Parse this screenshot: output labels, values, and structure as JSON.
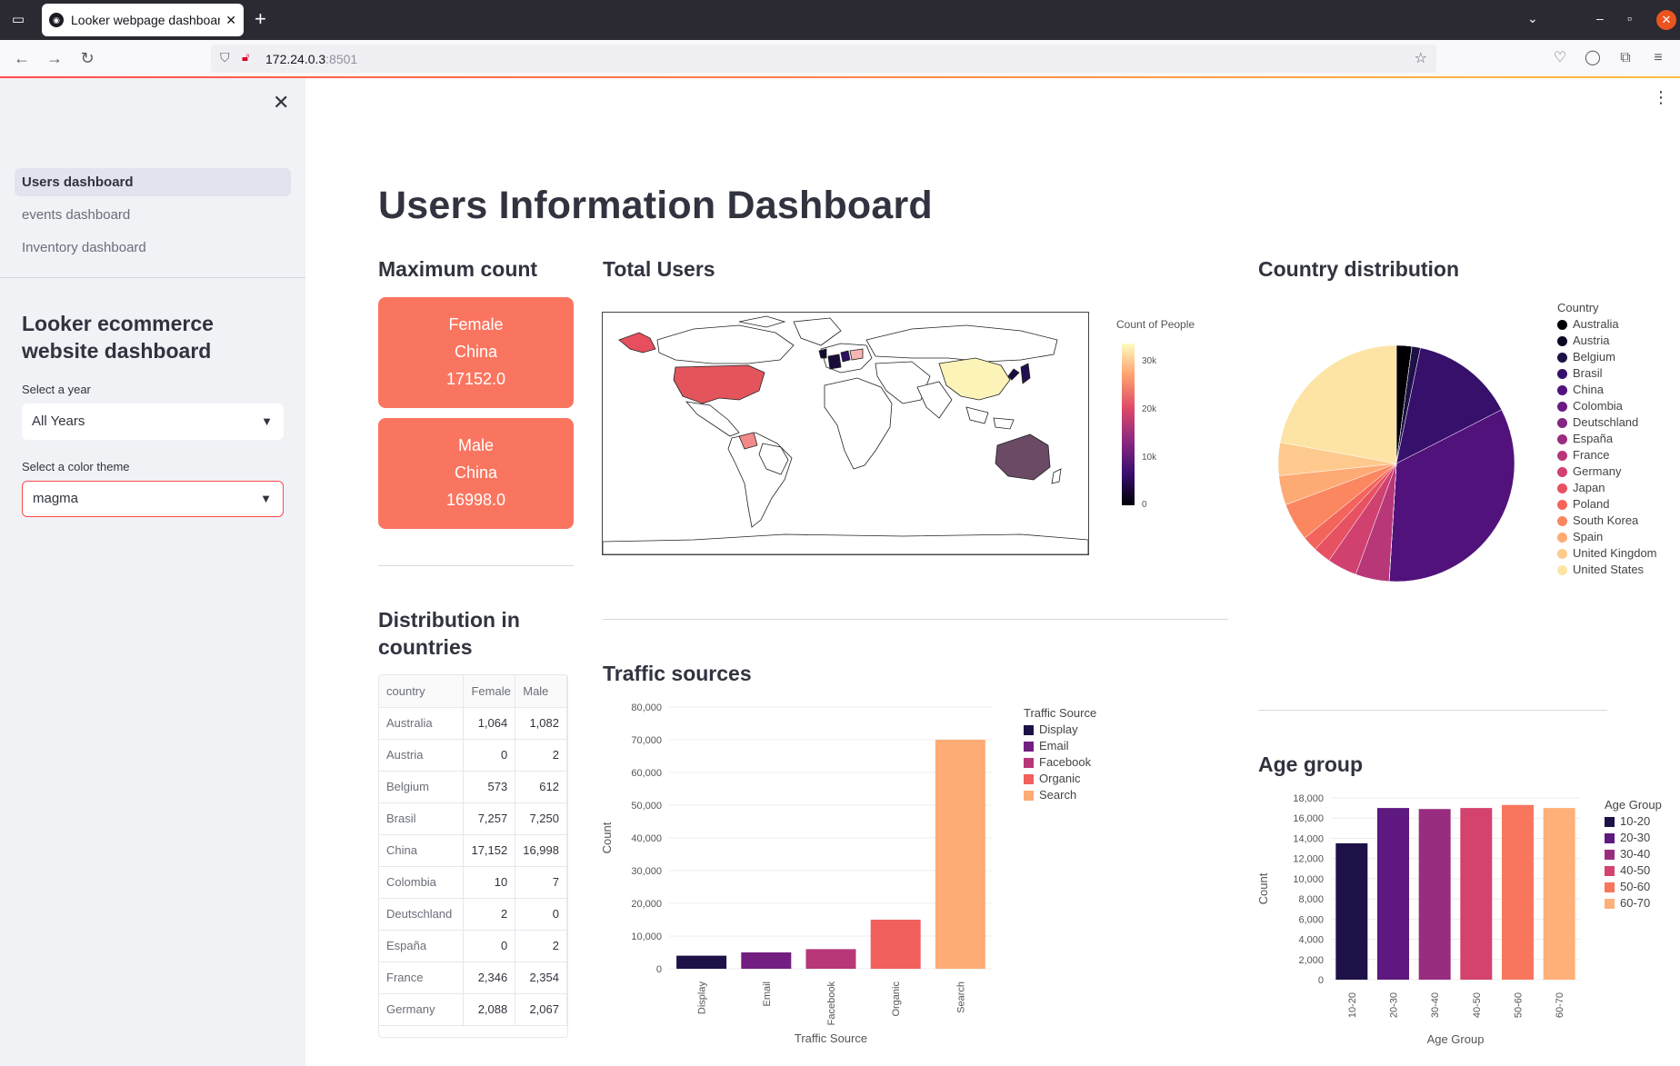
{
  "browser": {
    "tab_title": "Looker webpage dashboard",
    "url_host": "172.24.0.3",
    "url_port": ":8501"
  },
  "sidebar": {
    "nav": [
      {
        "label": "Users dashboard",
        "active": true
      },
      {
        "label": "events dashboard",
        "active": false
      },
      {
        "label": "Inventory dashboard",
        "active": false
      }
    ],
    "title": "Looker ecommerce website dashboard",
    "year_label": "Select a year",
    "year_value": "All Years",
    "theme_label": "Select a color theme",
    "theme_value": "magma"
  },
  "main": {
    "page_title": "Users Information Dashboard",
    "max_count": {
      "heading": "Maximum count",
      "cards": [
        {
          "gender": "Female",
          "country": "China",
          "value": "17152.0"
        },
        {
          "gender": "Male",
          "country": "China",
          "value": "16998.0"
        }
      ]
    },
    "total_users": {
      "heading": "Total Users",
      "colorbar_title": "Count of People",
      "colorbar_ticks": [
        "30k",
        "20k",
        "10k",
        "0"
      ]
    },
    "country_distribution": {
      "heading": "Country distribution"
    },
    "distribution": {
      "heading": "Distribution in countries",
      "columns": [
        "country",
        "Female",
        "Male"
      ],
      "rows": [
        [
          "Australia",
          "1,064",
          "1,082"
        ],
        [
          "Austria",
          "0",
          "2"
        ],
        [
          "Belgium",
          "573",
          "612"
        ],
        [
          "Brasil",
          "7,257",
          "7,250"
        ],
        [
          "China",
          "17,152",
          "16,998"
        ],
        [
          "Colombia",
          "10",
          "7"
        ],
        [
          "Deutschland",
          "2",
          "0"
        ],
        [
          "España",
          "0",
          "2"
        ],
        [
          "France",
          "2,346",
          "2,354"
        ],
        [
          "Germany",
          "2,088",
          "2,067"
        ]
      ]
    },
    "traffic": {
      "heading": "Traffic sources"
    },
    "age": {
      "heading": "Age group"
    }
  },
  "colors": {
    "accent": "#ff4b4b",
    "metric_card": "#fa7560",
    "magma": [
      "#000004",
      "#180f3d",
      "#440f76",
      "#721f81",
      "#9e2f7f",
      "#cd4071",
      "#f1605d",
      "#fd9668",
      "#feca8d",
      "#fcfdbf"
    ]
  },
  "chart_data": [
    {
      "type": "pie",
      "legend_title": "Country",
      "legend_position": "right",
      "labels": [
        "Australia",
        "Austria",
        "Belgium",
        "Brasil",
        "China",
        "Colombia",
        "Deutschland",
        "España",
        "France",
        "Germany",
        "Japan",
        "Poland",
        "South Korea",
        "Spain",
        "United Kingdom",
        "United States"
      ],
      "values": [
        2146,
        2,
        1185,
        14507,
        34150,
        17,
        2,
        2,
        4700,
        4155,
        2450,
        2100,
        5300,
        4100,
        4600,
        22600
      ],
      "colors": [
        "#000004",
        "#0b0924",
        "#1d1147",
        "#36106b",
        "#51127c",
        "#6a1c81",
        "#832681",
        "#9c2e7f",
        "#b73779",
        "#d0416f",
        "#e75263",
        "#f3655c",
        "#fb8761",
        "#feaa74",
        "#fec98d",
        "#fde4a5"
      ]
    },
    {
      "type": "bar",
      "xlabel": "Traffic Source",
      "ylabel": "Count",
      "legend_title": "Traffic Source",
      "legend_position": "right",
      "categories": [
        "Display",
        "Email",
        "Facebook",
        "Organic",
        "Search"
      ],
      "values": [
        4000,
        5000,
        6000,
        15000,
        70000
      ],
      "colors": [
        "#1d1147",
        "#721f81",
        "#b73779",
        "#f1605d",
        "#feac76"
      ],
      "ylim": [
        0,
        80000
      ],
      "yticks": [
        0,
        10000,
        20000,
        30000,
        40000,
        50000,
        60000,
        70000,
        80000
      ],
      "ytick_labels": [
        "0",
        "10,000",
        "20,000",
        "30,000",
        "40,000",
        "50,000",
        "60,000",
        "70,000",
        "80,000"
      ]
    },
    {
      "type": "bar",
      "xlabel": "Age Group",
      "ylabel": "Count",
      "legend_title": "Age Group",
      "legend_position": "right",
      "categories": [
        "10-20",
        "20-30",
        "30-40",
        "40-50",
        "50-60",
        "60-70"
      ],
      "values": [
        13500,
        17000,
        16900,
        17000,
        17300,
        17000
      ],
      "colors": [
        "#1d1147",
        "#5f187f",
        "#982d80",
        "#d3436e",
        "#f8765c",
        "#feb078"
      ],
      "ylim": [
        0,
        18000
      ],
      "yticks": [
        0,
        2000,
        4000,
        6000,
        8000,
        10000,
        12000,
        14000,
        16000,
        18000
      ],
      "ytick_labels": [
        "0",
        "2,000",
        "4,000",
        "6,000",
        "8,000",
        "10,000",
        "12,000",
        "14,000",
        "16,000",
        "18,000"
      ]
    }
  ]
}
